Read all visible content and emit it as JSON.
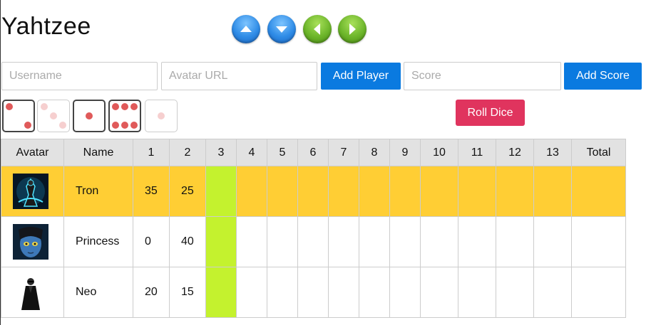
{
  "app": {
    "title": "Yahtzee"
  },
  "nav": {
    "up": "up-arrow",
    "down": "down-arrow",
    "left": "left-arrow",
    "right": "right-arrow"
  },
  "form": {
    "username_placeholder": "Username",
    "avatar_placeholder": "Avatar URL",
    "add_player_label": "Add Player",
    "score_placeholder": "Score",
    "add_score_label": "Add Score"
  },
  "dice": [
    {
      "value": 2,
      "held": true
    },
    {
      "value": 3,
      "held": false
    },
    {
      "value": 1,
      "held": true
    },
    {
      "value": 6,
      "held": true
    },
    {
      "value": 1,
      "held": false
    }
  ],
  "roll_label": "Roll Dice",
  "colors": {
    "accent_blue": "#0a7ae0",
    "roll_red": "#e0345e",
    "active_row": "#ffce34",
    "selected_column": "#c4f22e",
    "pip": "#e05a5a"
  },
  "table": {
    "headers": [
      "Avatar",
      "Name",
      "1",
      "2",
      "3",
      "4",
      "5",
      "6",
      "7",
      "8",
      "9",
      "10",
      "11",
      "12",
      "13",
      "Total"
    ],
    "rows": [
      {
        "name": "Tron",
        "avatar": "tron-avatar",
        "active": true,
        "scores": [
          "35",
          "25",
          "",
          "",
          "",
          "",
          "",
          "",
          "",
          "",
          "",
          "",
          ""
        ],
        "total": ""
      },
      {
        "name": "Princess",
        "avatar": "princess-avatar",
        "active": false,
        "scores": [
          "0",
          "40",
          "",
          "",
          "",
          "",
          "",
          "",
          "",
          "",
          "",
          "",
          ""
        ],
        "total": ""
      },
      {
        "name": "Neo",
        "avatar": "neo-avatar",
        "active": false,
        "scores": [
          "20",
          "15",
          "",
          "",
          "",
          "",
          "",
          "",
          "",
          "",
          "",
          "",
          ""
        ],
        "total": ""
      }
    ],
    "selected_column": "3"
  }
}
